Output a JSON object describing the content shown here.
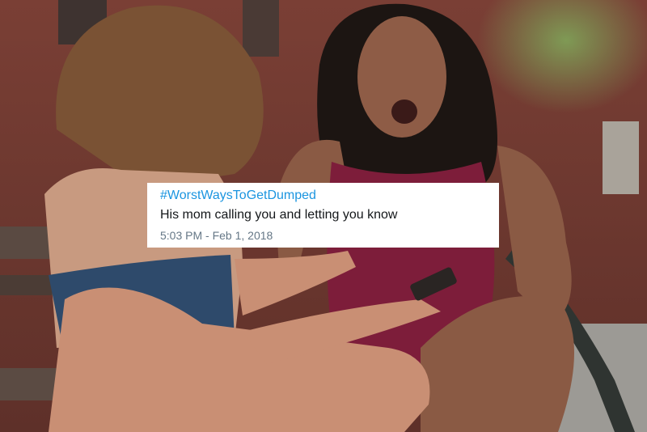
{
  "tweet": {
    "hashtag": "#WorstWaysToGetDumped",
    "text": "His mom calling you and letting you know",
    "timestamp": "5:03 PM - Feb 1, 2018"
  },
  "colors": {
    "hashtag": "#1b95e0",
    "text": "#14171a",
    "meta": "#657786",
    "card_background": "#ffffff"
  }
}
